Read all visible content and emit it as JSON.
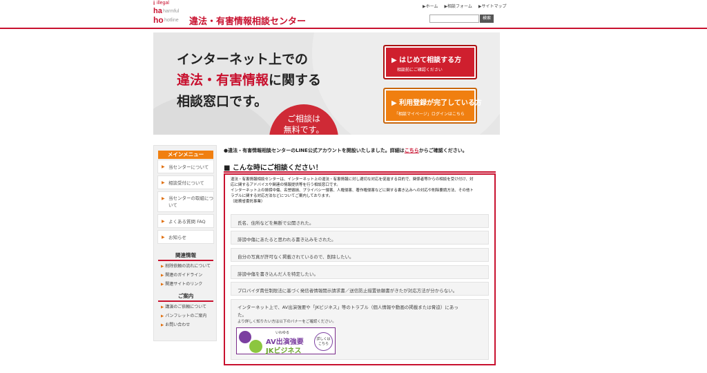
{
  "header": {
    "logo": {
      "l1": "illegal",
      "l2": "harmful",
      "l3": "hotline"
    },
    "site_title": "違法・有害情報相談センター",
    "nav": [
      "▶ホーム",
      "▶相談フォーム",
      "▶サイトマップ"
    ],
    "search_placeholder": "",
    "search_button": "検索"
  },
  "hero": {
    "line1": "インターネット上での",
    "line2_highlight": "違法・有害情報",
    "line2_rest": "に関する",
    "line3": "相談窓口です。",
    "free_badge": {
      "line1": "ご相談は",
      "line2": "無料です。"
    },
    "cta_first": {
      "main": "▶ はじめて相談する方",
      "sub": "相談前にご確認ください"
    },
    "cta_registered": {
      "main": "▶ 利用登録が完了している方",
      "sub": "「相談マイページ」ログインはこちら"
    }
  },
  "sidebar": {
    "menu_title": "メインメニュー",
    "items": [
      {
        "label": "当センターについて"
      },
      {
        "label": "相談受付について"
      },
      {
        "label": "当センターの取組について"
      },
      {
        "label": "よくある質問 FAQ"
      },
      {
        "label": "お知らせ"
      }
    ],
    "related_title": "関連情報",
    "related": [
      "削除依頼の流れについて",
      "関連のガイドライン",
      "関連サイトのリンク"
    ],
    "guide_title": "ご案内",
    "guide": [
      "講演のご依頼について",
      "パンフレットのご案内",
      "お問い合わせ"
    ]
  },
  "main": {
    "notice_prefix": "●違法・有害情報相談センターのLINE公式アカウントを開設いたしました。詳細は",
    "notice_link": "こちら",
    "notice_suffix": "からご確認ください。",
    "section_title": "■ こんな時にご相談ください！",
    "intro_lines": [
      "違法・有害情報相談センターは、インターネット上の違法・有害情報に対し適切な対応を促進する目的で、関係者等からの相談を受け付け、対",
      "応に関するアドバイスや関連の情報提供等を行う相談窓口です。",
      "インターネット上の誹謗中傷、名誉毀損、プライバシー侵害、人権侵害、著作権侵害などに関する書き込みへの対応や削除要請方法、その他ト",
      "ラブルに関する対応方法などについてご案内しております。",
      "（総務省委託事業）"
    ],
    "cases": [
      "氏名、住所などを無断で公開された。",
      "誹謗中傷にあたると思われる書き込みをされた。",
      "自分の写真が許可なく掲載されているので、削除したい。",
      "誹謗中傷を書き込んだ人を特定したい。",
      "プロバイダ責任制限法に基づく発信者情報開示請求書／送信防止措置依頼書がきたが対応方法が分からない。"
    ],
    "last_case": {
      "line1": "インターネット上で、AV出演強要や「JKビジネス」等のトラブル（個人情報や動画の掲載または脅迫）にあっ",
      "line2": "た。",
      "note": "より詳しく知りたい方は以下のバナーをご確認ください。"
    },
    "banner": {
      "small": "いわゆる",
      "line1": "AV出演強要",
      "line2": "JKビジネス",
      "more1": "詳しくは",
      "more2": "こちら"
    }
  },
  "colors": {
    "brand_red": "#c8102e",
    "accent_orange": "#f07f10"
  }
}
